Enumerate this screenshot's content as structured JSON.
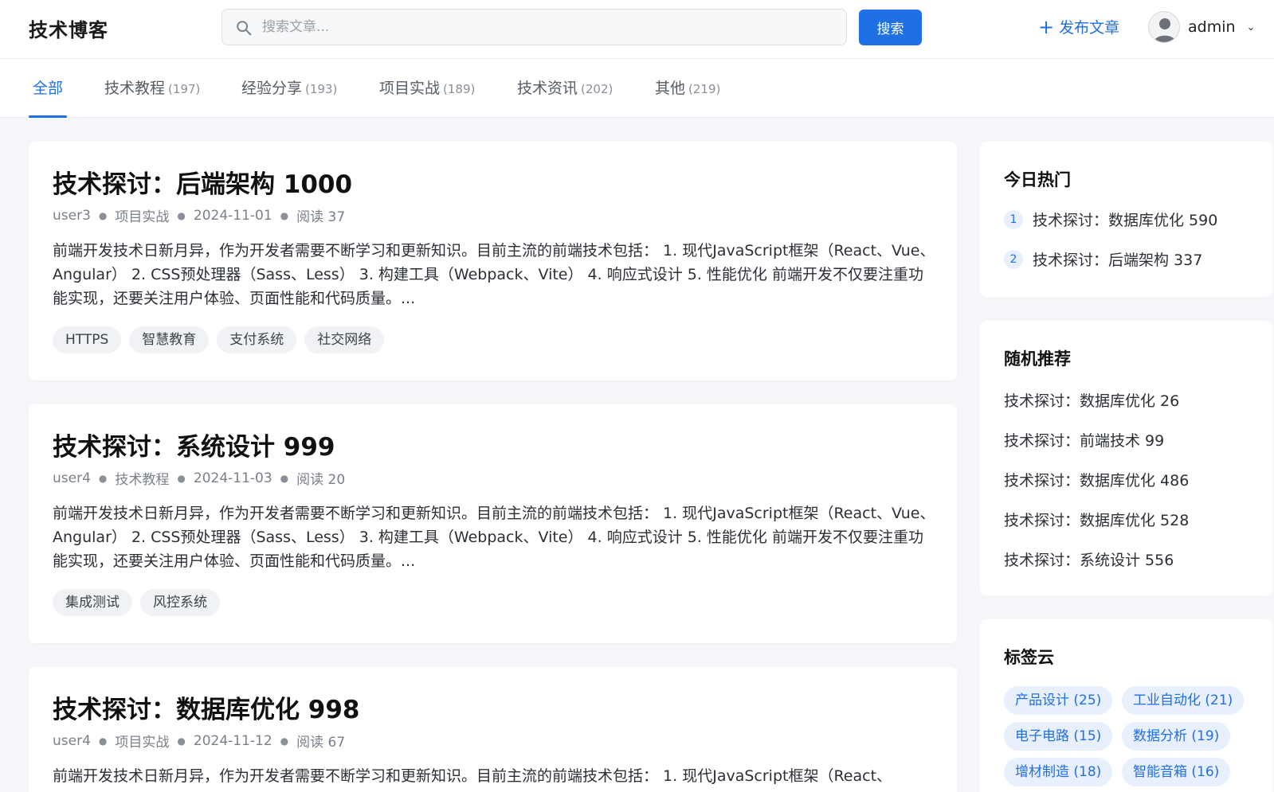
{
  "header": {
    "brand": "技术博客",
    "search_placeholder": "搜索文章...",
    "search_button": "搜索",
    "publish_label": "发布文章",
    "username": "admin"
  },
  "tabs": [
    {
      "label": "全部",
      "count": ""
    },
    {
      "label": "技术教程",
      "count": "(197)"
    },
    {
      "label": "经验分享",
      "count": "(193)"
    },
    {
      "label": "项目实战",
      "count": "(189)"
    },
    {
      "label": "技术资讯",
      "count": "(202)"
    },
    {
      "label": "其他",
      "count": "(219)"
    }
  ],
  "articles": [
    {
      "title": "技术探讨：后端架构 1000",
      "author": "user3",
      "category": "项目实战",
      "date": "2024-11-01",
      "reads": "阅读 37",
      "excerpt": "前端开发技术日新月异，作为开发者需要不断学习和更新知识。目前主流的前端技术包括： 1. 现代JavaScript框架（React、Vue、Angular） 2. CSS预处理器（Sass、Less） 3. 构建工具（Webpack、Vite） 4. 响应式设计 5. 性能优化 前端开发不仅要注重功能实现，还要关注用户体验、页面性能和代码质量。...",
      "tags": [
        "HTTPS",
        "智慧教育",
        "支付系统",
        "社交网络"
      ]
    },
    {
      "title": "技术探讨：系统设计 999",
      "author": "user4",
      "category": "技术教程",
      "date": "2024-11-03",
      "reads": "阅读 20",
      "excerpt": "前端开发技术日新月异，作为开发者需要不断学习和更新知识。目前主流的前端技术包括： 1. 现代JavaScript框架（React、Vue、Angular） 2. CSS预处理器（Sass、Less） 3. 构建工具（Webpack、Vite） 4. 响应式设计 5. 性能优化 前端开发不仅要注重功能实现，还要关注用户体验、页面性能和代码质量。...",
      "tags": [
        "集成测试",
        "风控系统"
      ]
    },
    {
      "title": "技术探讨：数据库优化 998",
      "author": "user4",
      "category": "项目实战",
      "date": "2024-11-12",
      "reads": "阅读 67",
      "excerpt": "前端开发技术日新月异，作为开发者需要不断学习和更新知识。目前主流的前端技术包括： 1. 现代JavaScript框架（React、",
      "tags": []
    }
  ],
  "sidebar": {
    "hot_title": "今日热门",
    "hot": [
      {
        "rank": "1",
        "title": "技术探讨：数据库优化 590"
      },
      {
        "rank": "2",
        "title": "技术探讨：后端架构 337"
      }
    ],
    "random_title": "随机推荐",
    "random": [
      "技术探讨：数据库优化 26",
      "技术探讨：前端技术 99",
      "技术探讨：数据库优化 486",
      "技术探讨：数据库优化 528",
      "技术探讨：系统设计 556"
    ],
    "cloud_title": "标签云",
    "cloud": [
      "产品设计 (25)",
      "工业自动化 (21)",
      "电子电路 (15)",
      "数据分析 (19)",
      "增材制造 (18)",
      "智能音箱 (16)"
    ]
  },
  "colors": {
    "accent": "#1f6fe5",
    "page_bg": "#f4f6f9",
    "chip_bg": "#f0f2f5",
    "cloud_chip_bg": "#e8f0fd"
  }
}
